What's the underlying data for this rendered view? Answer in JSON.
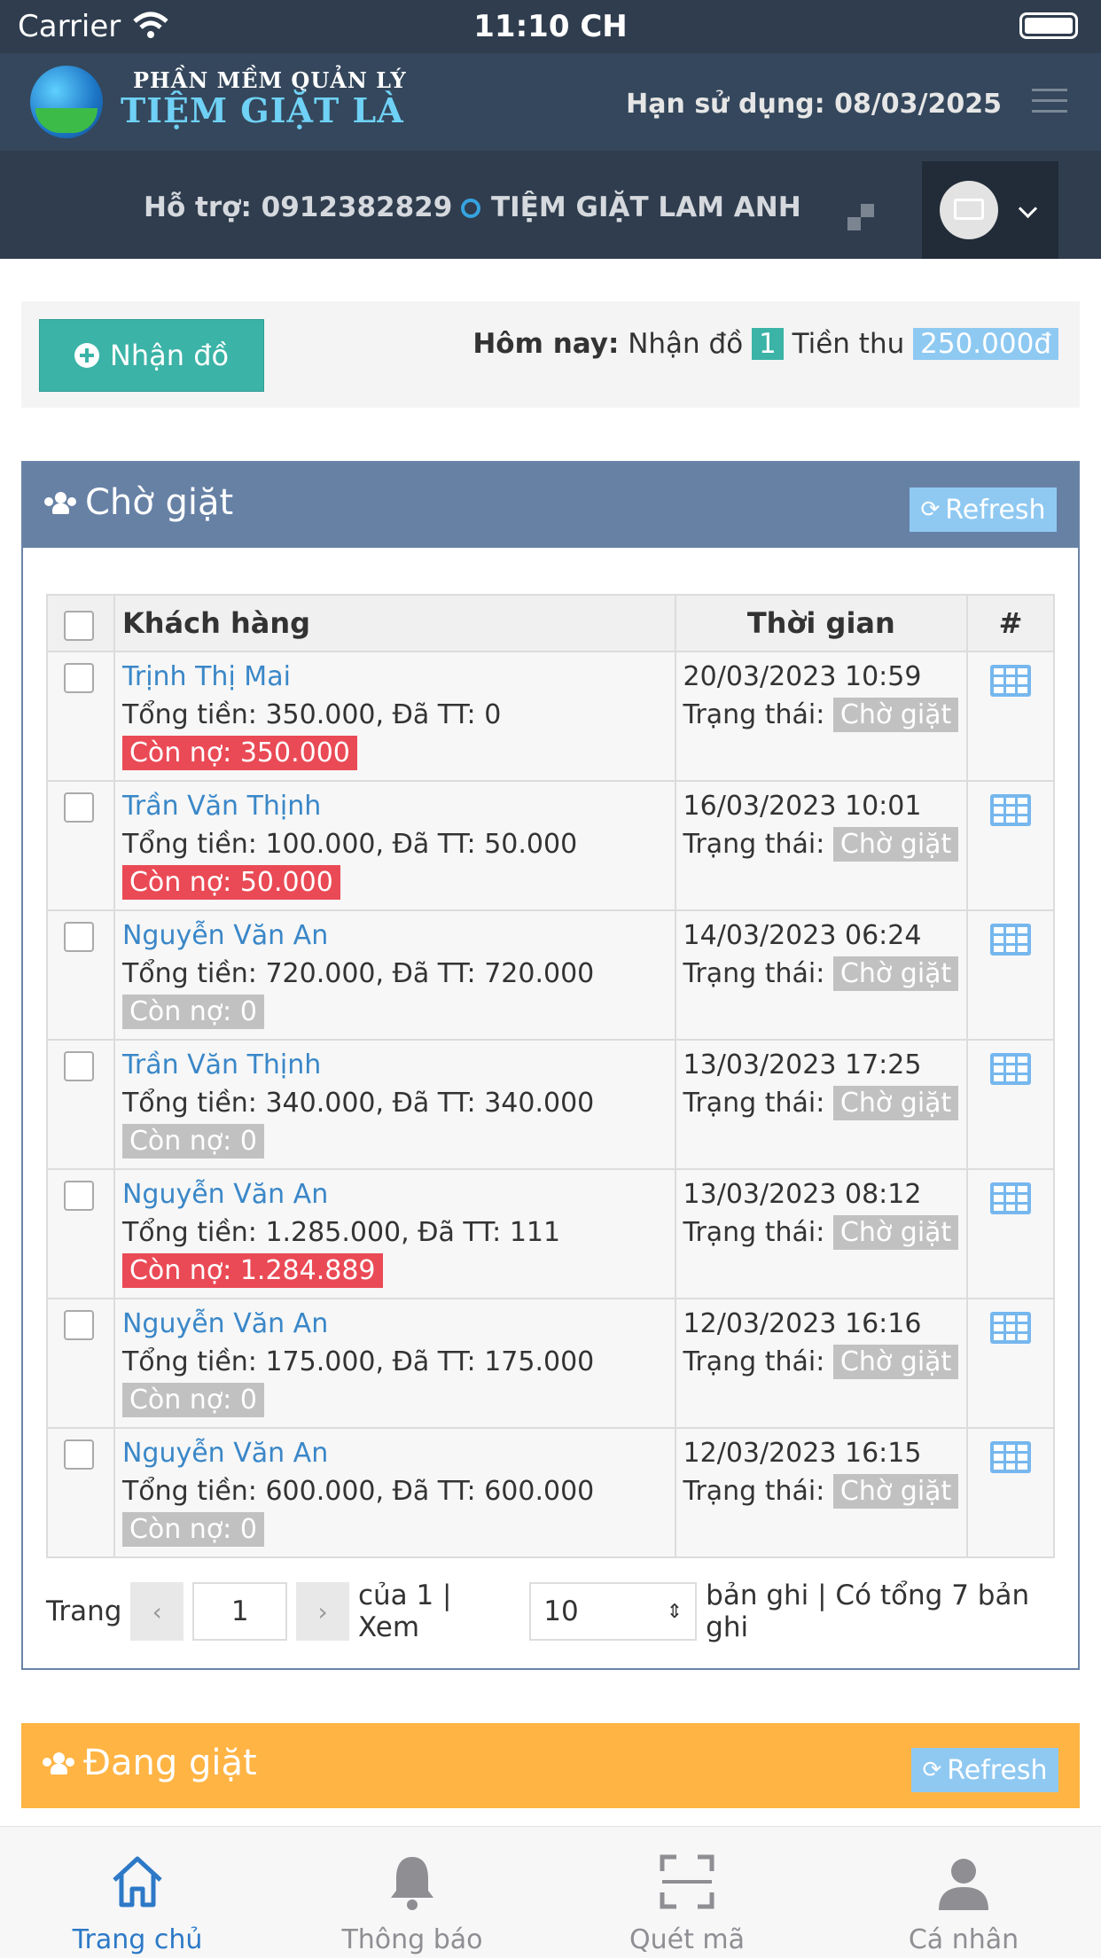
{
  "status_bar": {
    "carrier": "Carrier",
    "time": "11:10 CH"
  },
  "app_header": {
    "logo_top": "PHẦN MỀM QUẢN LÝ",
    "logo_main": "TIỆM GIẶT LÀ",
    "expiry": "Hạn sử dụng: 08/03/2025"
  },
  "sub_header": {
    "support": "Hỗ trợ: 0912382829",
    "shop_name": "TIỆM GIẶT LAM ANH"
  },
  "today": {
    "receive_button": "Nhận đồ",
    "label": "Hôm nay:",
    "received_label": "Nhận đồ",
    "received_count": "1",
    "revenue_label": "Tiền thu",
    "revenue_value": "250.000đ"
  },
  "waiting_panel": {
    "title": "Chờ giặt",
    "refresh": "Refresh",
    "columns": {
      "customer": "Khách hàng",
      "time": "Thời gian",
      "action": "#"
    },
    "status_label": "Trạng thái:",
    "rows": [
      {
        "customer": "Trịnh Thị Mai",
        "total": "Tổng tiền: 350.000, Đã TT: 0",
        "debt": "Còn nợ: 350.000",
        "debt_type": "red",
        "time": "20/03/2023 10:59",
        "status": "Chờ giặt"
      },
      {
        "customer": "Trần Văn Thịnh",
        "total": "Tổng tiền: 100.000, Đã TT: 50.000",
        "debt": "Còn nợ: 50.000",
        "debt_type": "red",
        "time": "16/03/2023 10:01",
        "status": "Chờ giặt"
      },
      {
        "customer": "Nguyễn Văn An",
        "total": "Tổng tiền: 720.000, Đã TT: 720.000",
        "debt": "Còn nợ: 0",
        "debt_type": "gray",
        "time": "14/03/2023 06:24",
        "status": "Chờ giặt"
      },
      {
        "customer": "Trần Văn Thịnh",
        "total": "Tổng tiền: 340.000, Đã TT: 340.000",
        "debt": "Còn nợ: 0",
        "debt_type": "gray",
        "time": "13/03/2023 17:25",
        "status": "Chờ giặt"
      },
      {
        "customer": "Nguyễn Văn An",
        "total": "Tổng tiền: 1.285.000, Đã TT: 111",
        "debt": "Còn nợ: 1.284.889",
        "debt_type": "red",
        "time": "13/03/2023 08:12",
        "status": "Chờ giặt"
      },
      {
        "customer": "Nguyễn Văn An",
        "total": "Tổng tiền: 175.000, Đã TT: 175.000",
        "debt": "Còn nợ: 0",
        "debt_type": "gray",
        "time": "12/03/2023 16:16",
        "status": "Chờ giặt"
      },
      {
        "customer": "Nguyễn Văn An",
        "total": "Tổng tiền: 600.000, Đã TT: 600.000",
        "debt": "Còn nợ: 0",
        "debt_type": "gray",
        "time": "12/03/2023 16:15",
        "status": "Chờ giặt"
      }
    ],
    "pager": {
      "page_label": "Trang",
      "prev": "‹",
      "page": "1",
      "next": "›",
      "of_text": "của 1 | Xem",
      "per_page": "10",
      "records_text": "bản ghi | Có tổng 7 bản ghi"
    }
  },
  "washing_panel": {
    "title": "Đang giặt",
    "refresh": "Refresh"
  },
  "tab_bar": {
    "tabs": [
      {
        "label": "Trang chủ",
        "icon": "home-icon"
      },
      {
        "label": "Thông báo",
        "icon": "bell-icon"
      },
      {
        "label": "Quét mã",
        "icon": "scan-icon"
      },
      {
        "label": "Cá nhân",
        "icon": "person-icon"
      }
    ]
  },
  "colors": {
    "header_bg": "#34475c",
    "accent_teal": "#3bb3a7",
    "panel_blue": "#6781a5",
    "panel_orange": "#ffb444",
    "debt_red": "#ea4a55",
    "link_blue": "#3a87c8",
    "tab_active": "#2d79c7"
  }
}
